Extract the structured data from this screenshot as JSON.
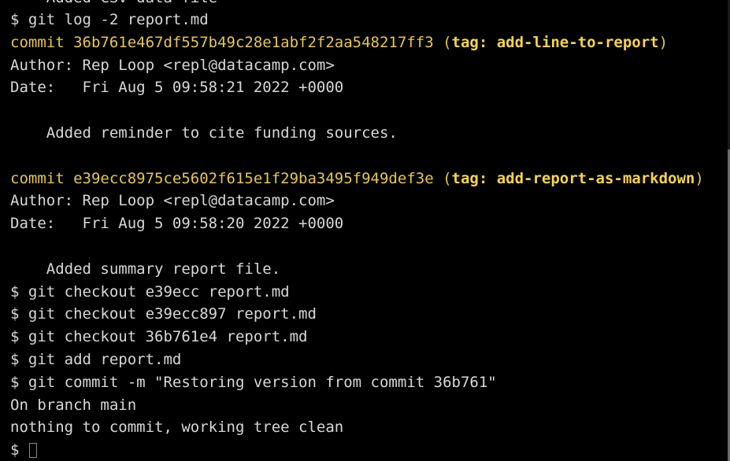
{
  "terminal": {
    "partial_top": "    Added CSV data file",
    "cmd1": "$ git log -2 report.md",
    "commit1": {
      "prefix": "commit 36b761e467df557b49c28e1abf2f2aa548217ff3 (",
      "tag": "tag: add-line-to-report",
      "suffix": ")",
      "author": "Author: Rep Loop <repl@datacamp.com>",
      "date": "Date:   Fri Aug 5 09:58:21 2022 +0000",
      "message": "    Added reminder to cite funding sources."
    },
    "commit2": {
      "prefix": "commit e39ecc8975ce5602f615e1f29ba3495f949def3e (",
      "tag": "tag: add-report-as-markdown",
      "suffix": ")",
      "author": "Author: Rep Loop <repl@datacamp.com>",
      "date": "Date:   Fri Aug 5 09:58:20 2022 +0000",
      "message": "    Added summary report file."
    },
    "cmd2": "$ git checkout e39ecc report.md",
    "cmd3": "$ git checkout e39ecc897 report.md",
    "cmd4": "$ git checkout 36b761e4 report.md",
    "cmd5": "$ git add report.md",
    "cmd6": "$ git commit -m \"Restoring version from commit 36b761\"",
    "out1": "On branch main",
    "out2": "nothing to commit, working tree clean",
    "prompt": "$ "
  },
  "colors": {
    "background": "#000000",
    "text": "#d8d8d8",
    "commit": "#e6c84a",
    "tag": "#f5d547"
  }
}
